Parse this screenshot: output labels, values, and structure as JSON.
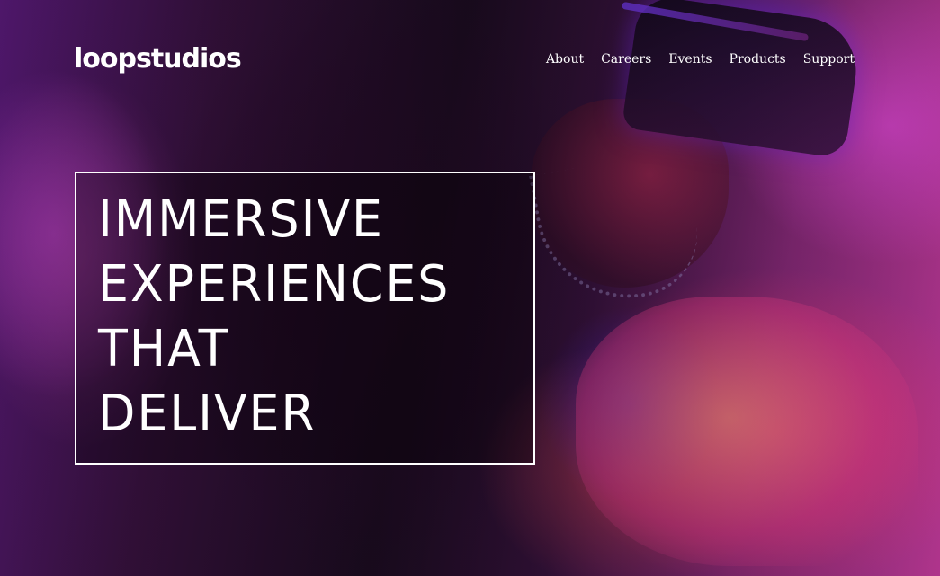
{
  "header": {
    "logo": "loopstudios",
    "nav": [
      {
        "label": "About"
      },
      {
        "label": "Careers"
      },
      {
        "label": "Events"
      },
      {
        "label": "Products"
      },
      {
        "label": "Support"
      }
    ]
  },
  "hero": {
    "headline_lines": [
      "IMMERSIVE",
      "EXPERIENCES",
      "THAT",
      "DELIVER"
    ],
    "background_colors": {
      "left": "#5a1a7a",
      "center": "#1e0d22",
      "right": "#c23a9a",
      "accent": "#eb3c78"
    }
  }
}
